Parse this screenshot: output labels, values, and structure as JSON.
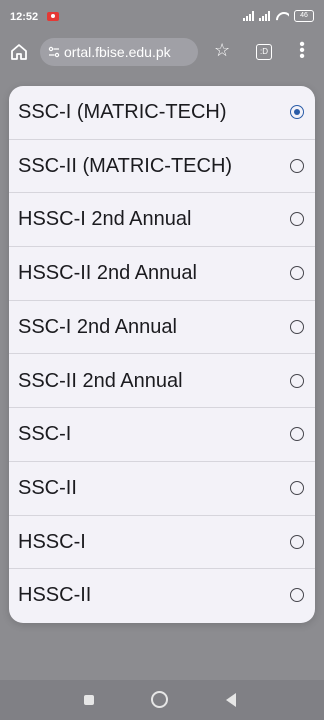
{
  "status_bar": {
    "time": "12:52",
    "battery": "46"
  },
  "toolbar": {
    "url": "ortal.fbise.edu.pk",
    "tab_count": ":D"
  },
  "dialog": {
    "options": [
      {
        "label": "SSC-I (MATRIC-TECH)",
        "selected": true
      },
      {
        "label": "SSC-II (MATRIC-TECH)",
        "selected": false
      },
      {
        "label": "HSSC-I 2nd Annual",
        "selected": false
      },
      {
        "label": "HSSC-II 2nd Annual",
        "selected": false
      },
      {
        "label": "SSC-I 2nd Annual",
        "selected": false
      },
      {
        "label": "SSC-II 2nd Annual",
        "selected": false
      },
      {
        "label": "SSC-I",
        "selected": false
      },
      {
        "label": "SSC-II",
        "selected": false
      },
      {
        "label": "HSSC-I",
        "selected": false
      },
      {
        "label": "HSSC-II",
        "selected": false
      }
    ]
  },
  "colors": {
    "accent": "#2a5ca8",
    "scrim": "#8c8c90",
    "dialog_bg": "#f3f2f8"
  }
}
